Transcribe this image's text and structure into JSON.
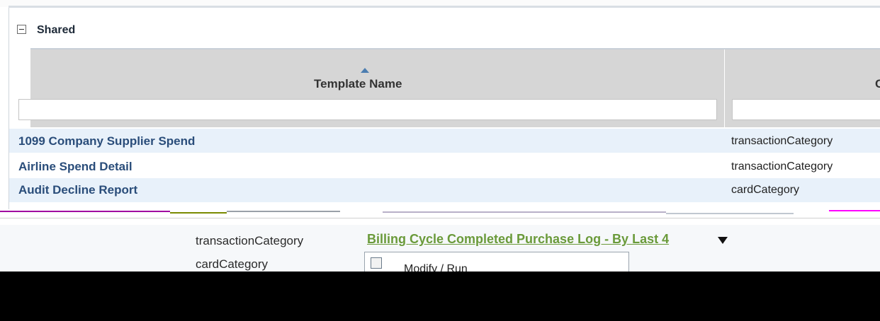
{
  "panel": {
    "title": "Shared"
  },
  "table": {
    "columns": [
      {
        "label": "Template Name",
        "sorted": "ascending"
      },
      {
        "label": "C"
      }
    ],
    "rows": [
      {
        "name": "1099 Company Supplier Spend",
        "category": "transactionCategory"
      },
      {
        "name": "Airline Spend Detail",
        "category": "transactionCategory"
      },
      {
        "name": "Audit Decline Report",
        "category": "cardCategory"
      }
    ]
  },
  "lower": {
    "rows": [
      {
        "category": "transactionCategory"
      },
      {
        "category": "cardCategory"
      }
    ],
    "link": "Billing Cycle Completed Purchase Log - By Last 4",
    "menu_item": "Modify / Run"
  },
  "colors": {
    "header_bg": "#d6d6d6",
    "alt_row_bg": "#e8f1fa",
    "name_link": "#2a4d7a",
    "green_link": "#6a9a3a"
  }
}
